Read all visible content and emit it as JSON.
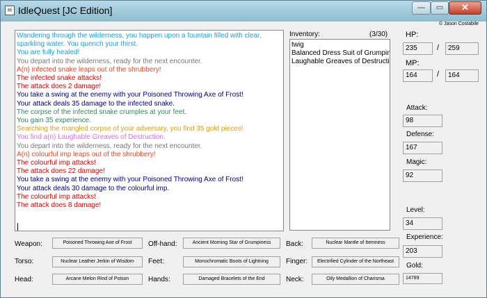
{
  "window": {
    "title": "IdleQuest [JC Edition]",
    "app_icon_glyph": "☠",
    "minimize_glyph": "—",
    "maximize_glyph": "▭",
    "close_glyph": "✕",
    "copyright": "© Jason Costabile"
  },
  "log": {
    "lines": [
      {
        "text": "Wandering through the wilderness, you happen upon a fountain filled with clear,",
        "color": "#1aa0d8"
      },
      {
        "text": "sparkling water.  You quench your thirst.",
        "color": "#1aa0d8"
      },
      {
        "text": "You are fully healed!",
        "color": "#1aa0d8"
      },
      {
        "text": "You depart into the wilderness, ready for the next encounter.",
        "color": "#777777"
      },
      {
        "text": "A(n) infected snake leaps out of the shrubbery!",
        "color": "#ee4422"
      },
      {
        "text": "The infected snake attacks!",
        "color": "#dd0000"
      },
      {
        "text": "The attack does 2 damage!",
        "color": "#dd0000"
      },
      {
        "text": "You take a swing at the enemy with your Poisoned Throwing Axe of Frost!",
        "color": "#000080"
      },
      {
        "text": "Your attack deals 35 damage to the infected snake.",
        "color": "#000080"
      },
      {
        "text": "The corpse of the infected snake crumples at your feet.",
        "color": "#2e8b57"
      },
      {
        "text": "You gain 35 experience.",
        "color": "#2e8b57"
      },
      {
        "text": "Searching the mangled corpse of your adversary, you find 35 gold pieces!",
        "color": "#d4a017"
      },
      {
        "text": "You find a(n) Laughable Greaves of Destruction.",
        "color": "#da70d6"
      },
      {
        "text": "You depart into the wilderness, ready for the next encounter.",
        "color": "#777777"
      },
      {
        "text": "A(n) colourful imp leaps out of the shrubbery!",
        "color": "#ee4422"
      },
      {
        "text": "The colourful imp attacks!",
        "color": "#dd0000"
      },
      {
        "text": "The attack does 22 damage!",
        "color": "#dd0000"
      },
      {
        "text": "You take a swing at the enemy with your Poisoned Throwing Axe of Frost!",
        "color": "#000080"
      },
      {
        "text": "Your attack deals 30 damage to the colourful imp.",
        "color": "#000080"
      },
      {
        "text": "The colourful imp attacks!",
        "color": "#dd0000"
      },
      {
        "text": "The attack does 8 damage!",
        "color": "#dd0000"
      }
    ]
  },
  "inventory": {
    "label": "Inventory:",
    "count": "(3/30)",
    "items": [
      "twig",
      "Balanced Dress Suit of Grumpiness",
      "Laughable Greaves of Destruction"
    ]
  },
  "stats": {
    "hp_label": "HP:",
    "hp_current": "235",
    "hp_max": "259",
    "mp_label": "MP:",
    "mp_current": "164",
    "mp_max": "164",
    "separator": "/",
    "attack_label": "Attack:",
    "attack": "98",
    "defense_label": "Defense:",
    "defense": "167",
    "magic_label": "Magic:",
    "magic": "92",
    "level_label": "Level:",
    "level": "34",
    "experience_label": "Experience:",
    "experience": "203",
    "gold_label": "Gold:",
    "gold": "14789"
  },
  "equipment": {
    "weapon_label": "Weapon:",
    "weapon": "Poisoned Throwing Axe of Frost",
    "torso_label": "Torso:",
    "torso": "Nuclear Leather Jerkin of Wisdom",
    "head_label": "Head:",
    "head": "Arcane Melon Rind of Poison",
    "offhand_label": "Off-hand:",
    "offhand": "Ancient Morning Star of Grumpiness",
    "feet_label": "Feet:",
    "feet": "Monochromatic Boots of Lightning",
    "hands_label": "Hands:",
    "hands": "Damaged Bracelets of the End",
    "back_label": "Back:",
    "back": "Nuclear Mantle of Itemness",
    "finger_label": "Finger:",
    "finger": "Electrified Cylinder of the Northeast",
    "neck_label": "Neck:",
    "neck": "Oily Medallion of Charisma"
  }
}
